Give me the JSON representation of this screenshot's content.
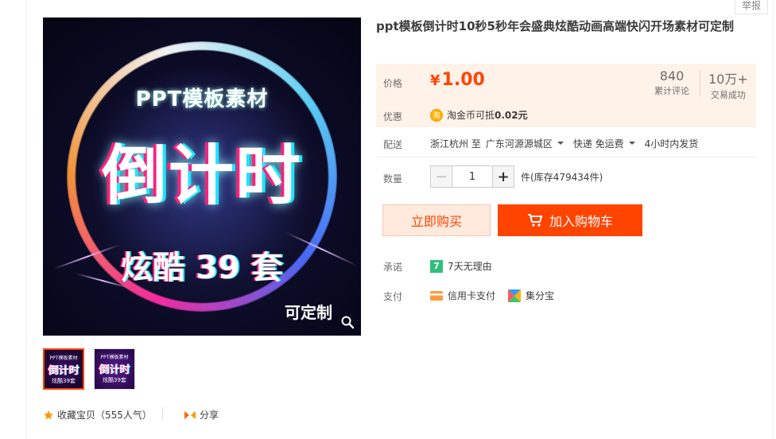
{
  "report_label": "举报",
  "gallery": {
    "main": {
      "line1": "PPT模板素材",
      "line2": "倒计时",
      "line3": "炫酷 39 套",
      "line4": "可定制"
    },
    "thumbs": [
      {
        "line1": "PPT模板素材",
        "line2": "倒计时",
        "line3": "炫酷39套"
      },
      {
        "line1": "PPT模板素材",
        "line2": "倒计时",
        "line3": "炫酷39套"
      }
    ]
  },
  "actions": {
    "collect_label": "收藏宝贝（555人气）",
    "share_label": "分享"
  },
  "product": {
    "title": "ppt模板倒计时10秒5秒年会盛典炫酷动画高端快闪开场素材可定制",
    "price_label": "价格",
    "currency": "¥",
    "price": "1.00",
    "stats": [
      {
        "num": "840",
        "label": "累计评论"
      },
      {
        "num": "10万+",
        "label": "交易成功"
      }
    ],
    "discount_label": "优惠",
    "coin_icon_text": "淘",
    "discount_prefix": "淘金币可抵",
    "discount_amount": "0.02元",
    "delivery_label": "配送",
    "delivery_from": "浙江杭州 至",
    "delivery_to": "广东河源源城区",
    "delivery_method": "快递 免运费",
    "delivery_time": "4小时内发货",
    "quantity_label": "数量",
    "quantity_minus": "−",
    "quantity_value": "1",
    "quantity_plus": "+",
    "stock_text": "件(库存479434件)",
    "buy_now": "立即购买",
    "add_cart": "加入购物车",
    "promise_label": "承诺",
    "promise_icon_text": "7",
    "promise_text": "7天无理由",
    "pay_label": "支付",
    "pay_methods": [
      "信用卡支付",
      "集分宝"
    ]
  },
  "colors": {
    "accent": "#ff4400",
    "price_bg": "#fff2e8",
    "buy_bg": "#ffeadd"
  }
}
